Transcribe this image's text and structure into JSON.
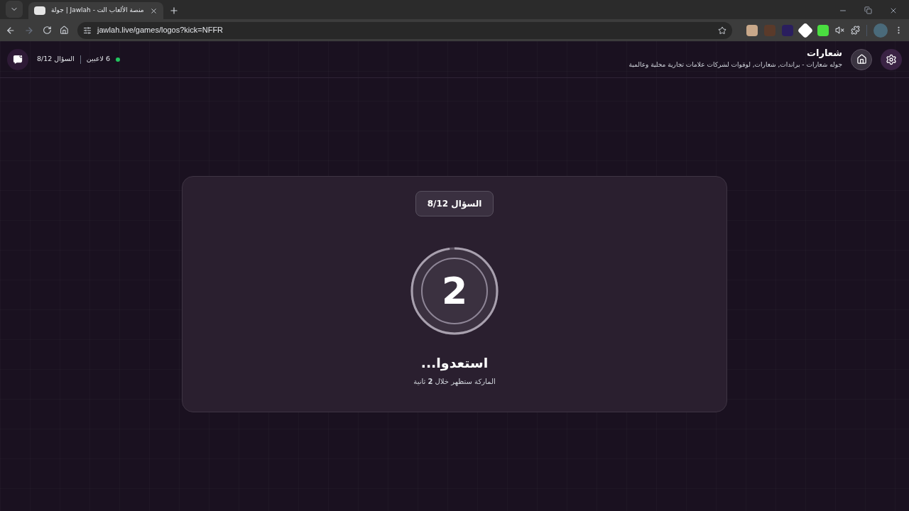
{
  "browser": {
    "tab": {
      "title": "جولة | Jawlah - منصة الألعاب الت"
    },
    "address": "jawlah.live/games/logos?kick=NFFR"
  },
  "header": {
    "title": "شعارات",
    "subtitle": "جوله شعارات - براندات, شعارات, لوقوات لشركات علامات تجارية محلية وعالمية",
    "online": true,
    "players": "6 لاعبين",
    "question": "السؤال 8/12"
  },
  "card": {
    "badge": "السؤال 8/12",
    "countdown": "2",
    "heading": "استعدوا...",
    "message": "الماركة ستظهر خلال **2** ثانية"
  }
}
